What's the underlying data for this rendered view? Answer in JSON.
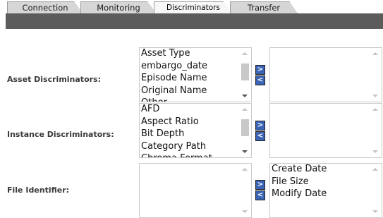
{
  "tabs": [
    {
      "label": "Connection"
    },
    {
      "label": "Monitoring"
    },
    {
      "label": "Discriminators"
    },
    {
      "label": "Transfer"
    }
  ],
  "rows": [
    {
      "label": "Asset Discriminators:",
      "available": [
        "Asset Type",
        "embargo_date",
        "Episode Name",
        "Original Name",
        "Other..."
      ],
      "selected": []
    },
    {
      "label": "Instance Discriminators:",
      "available": [
        "AFD",
        "Aspect Ratio",
        "Bit Depth",
        "Category Path",
        "Chroma Format"
      ],
      "selected": []
    },
    {
      "label": "File Identifier:",
      "available": [],
      "selected": [
        "Create Date",
        "File Size",
        "Modify Date"
      ]
    }
  ],
  "buttons": {
    "add": ">",
    "remove": "<"
  },
  "icons": {
    "scroll_up": "chevron-up-icon",
    "scroll_down": "chevron-down-icon"
  }
}
